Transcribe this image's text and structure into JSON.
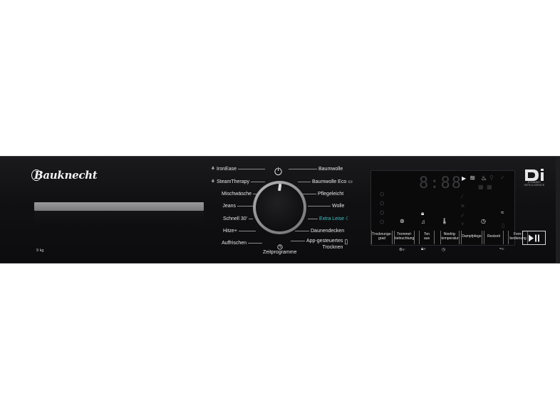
{
  "brand": "Bauknecht",
  "capacity": "9 kg",
  "programs_left": [
    {
      "label": "IronEase",
      "icon": "iron-ease-icon",
      "glyph": "⚘"
    },
    {
      "label": "SteamTherapy",
      "icon": "steam-therapy-icon",
      "glyph": "⚘"
    },
    {
      "label": "Mischwäsche"
    },
    {
      "label": "Jeans"
    },
    {
      "label": "Schnell 30'"
    },
    {
      "label": "Hitze+"
    },
    {
      "label": "Auffrischen"
    }
  ],
  "programs_right": [
    {
      "label": "Baumwolle"
    },
    {
      "label": "Baumwolle Eco",
      "icon": "eco-tag-icon",
      "glyph": "▭"
    },
    {
      "label": "Pflegeleicht"
    },
    {
      "label": "Wolle"
    },
    {
      "label": "Extra Leise",
      "icon": "quiet-icon",
      "glyph": "☾",
      "highlight": true
    },
    {
      "label": "Daunendecken"
    },
    {
      "label": "App-gesteuertes",
      "label2": "Trocknen",
      "icon": "phone-icon",
      "glyph": "▯"
    }
  ],
  "zeit_label": "Zeitprogramme",
  "display": {
    "time": "8:88"
  },
  "buttons": [
    {
      "line1": "Trocknungs-",
      "line2": "grad"
    },
    {
      "line1": "Trommel-",
      "line2": "beleuchtung"
    },
    {
      "line1": "Ton",
      "line2": "aus"
    },
    {
      "line1": "Niedrig-",
      "line2": "temperatur"
    },
    {
      "line1": "Dampfpfege",
      "line2": ""
    },
    {
      "line1": "Restzeit",
      "line2": ""
    },
    {
      "line1": "Fern-",
      "line2": "bedienung"
    }
  ],
  "sub_labels": {
    "drum": "3\"",
    "lock": "3\"",
    "wifi": "3\""
  },
  "di_logo_text": "DYNAMIC INTELLIGENCE",
  "colors": {
    "panel": "#111113",
    "highlight": "#3fc7c9",
    "drawer": "#8a8a8c"
  }
}
